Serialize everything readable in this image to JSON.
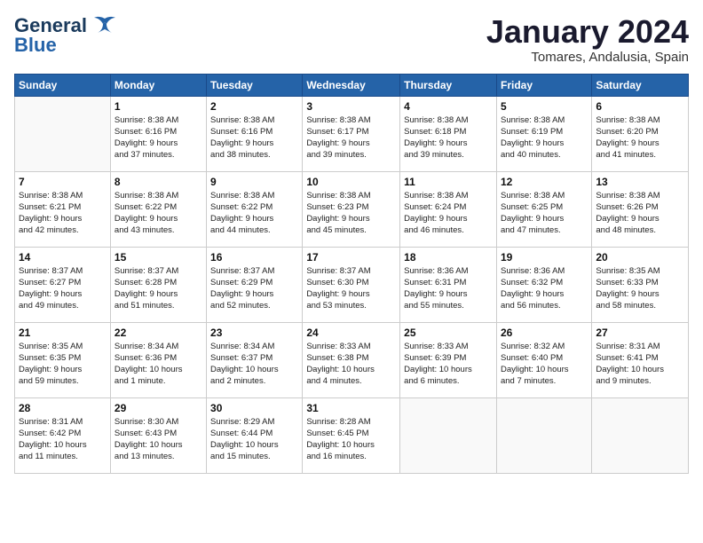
{
  "header": {
    "logo": {
      "general": "General",
      "blue": "Blue"
    },
    "title": "January 2024",
    "location": "Tomares, Andalusia, Spain"
  },
  "days_of_week": [
    "Sunday",
    "Monday",
    "Tuesday",
    "Wednesday",
    "Thursday",
    "Friday",
    "Saturday"
  ],
  "weeks": [
    [
      {
        "day": "",
        "info": ""
      },
      {
        "day": "1",
        "info": "Sunrise: 8:38 AM\nSunset: 6:16 PM\nDaylight: 9 hours\nand 37 minutes."
      },
      {
        "day": "2",
        "info": "Sunrise: 8:38 AM\nSunset: 6:16 PM\nDaylight: 9 hours\nand 38 minutes."
      },
      {
        "day": "3",
        "info": "Sunrise: 8:38 AM\nSunset: 6:17 PM\nDaylight: 9 hours\nand 39 minutes."
      },
      {
        "day": "4",
        "info": "Sunrise: 8:38 AM\nSunset: 6:18 PM\nDaylight: 9 hours\nand 39 minutes."
      },
      {
        "day": "5",
        "info": "Sunrise: 8:38 AM\nSunset: 6:19 PM\nDaylight: 9 hours\nand 40 minutes."
      },
      {
        "day": "6",
        "info": "Sunrise: 8:38 AM\nSunset: 6:20 PM\nDaylight: 9 hours\nand 41 minutes."
      }
    ],
    [
      {
        "day": "7",
        "info": "Sunrise: 8:38 AM\nSunset: 6:21 PM\nDaylight: 9 hours\nand 42 minutes."
      },
      {
        "day": "8",
        "info": "Sunrise: 8:38 AM\nSunset: 6:22 PM\nDaylight: 9 hours\nand 43 minutes."
      },
      {
        "day": "9",
        "info": "Sunrise: 8:38 AM\nSunset: 6:22 PM\nDaylight: 9 hours\nand 44 minutes."
      },
      {
        "day": "10",
        "info": "Sunrise: 8:38 AM\nSunset: 6:23 PM\nDaylight: 9 hours\nand 45 minutes."
      },
      {
        "day": "11",
        "info": "Sunrise: 8:38 AM\nSunset: 6:24 PM\nDaylight: 9 hours\nand 46 minutes."
      },
      {
        "day": "12",
        "info": "Sunrise: 8:38 AM\nSunset: 6:25 PM\nDaylight: 9 hours\nand 47 minutes."
      },
      {
        "day": "13",
        "info": "Sunrise: 8:38 AM\nSunset: 6:26 PM\nDaylight: 9 hours\nand 48 minutes."
      }
    ],
    [
      {
        "day": "14",
        "info": "Sunrise: 8:37 AM\nSunset: 6:27 PM\nDaylight: 9 hours\nand 49 minutes."
      },
      {
        "day": "15",
        "info": "Sunrise: 8:37 AM\nSunset: 6:28 PM\nDaylight: 9 hours\nand 51 minutes."
      },
      {
        "day": "16",
        "info": "Sunrise: 8:37 AM\nSunset: 6:29 PM\nDaylight: 9 hours\nand 52 minutes."
      },
      {
        "day": "17",
        "info": "Sunrise: 8:37 AM\nSunset: 6:30 PM\nDaylight: 9 hours\nand 53 minutes."
      },
      {
        "day": "18",
        "info": "Sunrise: 8:36 AM\nSunset: 6:31 PM\nDaylight: 9 hours\nand 55 minutes."
      },
      {
        "day": "19",
        "info": "Sunrise: 8:36 AM\nSunset: 6:32 PM\nDaylight: 9 hours\nand 56 minutes."
      },
      {
        "day": "20",
        "info": "Sunrise: 8:35 AM\nSunset: 6:33 PM\nDaylight: 9 hours\nand 58 minutes."
      }
    ],
    [
      {
        "day": "21",
        "info": "Sunrise: 8:35 AM\nSunset: 6:35 PM\nDaylight: 9 hours\nand 59 minutes."
      },
      {
        "day": "22",
        "info": "Sunrise: 8:34 AM\nSunset: 6:36 PM\nDaylight: 10 hours\nand 1 minute."
      },
      {
        "day": "23",
        "info": "Sunrise: 8:34 AM\nSunset: 6:37 PM\nDaylight: 10 hours\nand 2 minutes."
      },
      {
        "day": "24",
        "info": "Sunrise: 8:33 AM\nSunset: 6:38 PM\nDaylight: 10 hours\nand 4 minutes."
      },
      {
        "day": "25",
        "info": "Sunrise: 8:33 AM\nSunset: 6:39 PM\nDaylight: 10 hours\nand 6 minutes."
      },
      {
        "day": "26",
        "info": "Sunrise: 8:32 AM\nSunset: 6:40 PM\nDaylight: 10 hours\nand 7 minutes."
      },
      {
        "day": "27",
        "info": "Sunrise: 8:31 AM\nSunset: 6:41 PM\nDaylight: 10 hours\nand 9 minutes."
      }
    ],
    [
      {
        "day": "28",
        "info": "Sunrise: 8:31 AM\nSunset: 6:42 PM\nDaylight: 10 hours\nand 11 minutes."
      },
      {
        "day": "29",
        "info": "Sunrise: 8:30 AM\nSunset: 6:43 PM\nDaylight: 10 hours\nand 13 minutes."
      },
      {
        "day": "30",
        "info": "Sunrise: 8:29 AM\nSunset: 6:44 PM\nDaylight: 10 hours\nand 15 minutes."
      },
      {
        "day": "31",
        "info": "Sunrise: 8:28 AM\nSunset: 6:45 PM\nDaylight: 10 hours\nand 16 minutes."
      },
      {
        "day": "",
        "info": ""
      },
      {
        "day": "",
        "info": ""
      },
      {
        "day": "",
        "info": ""
      }
    ]
  ]
}
